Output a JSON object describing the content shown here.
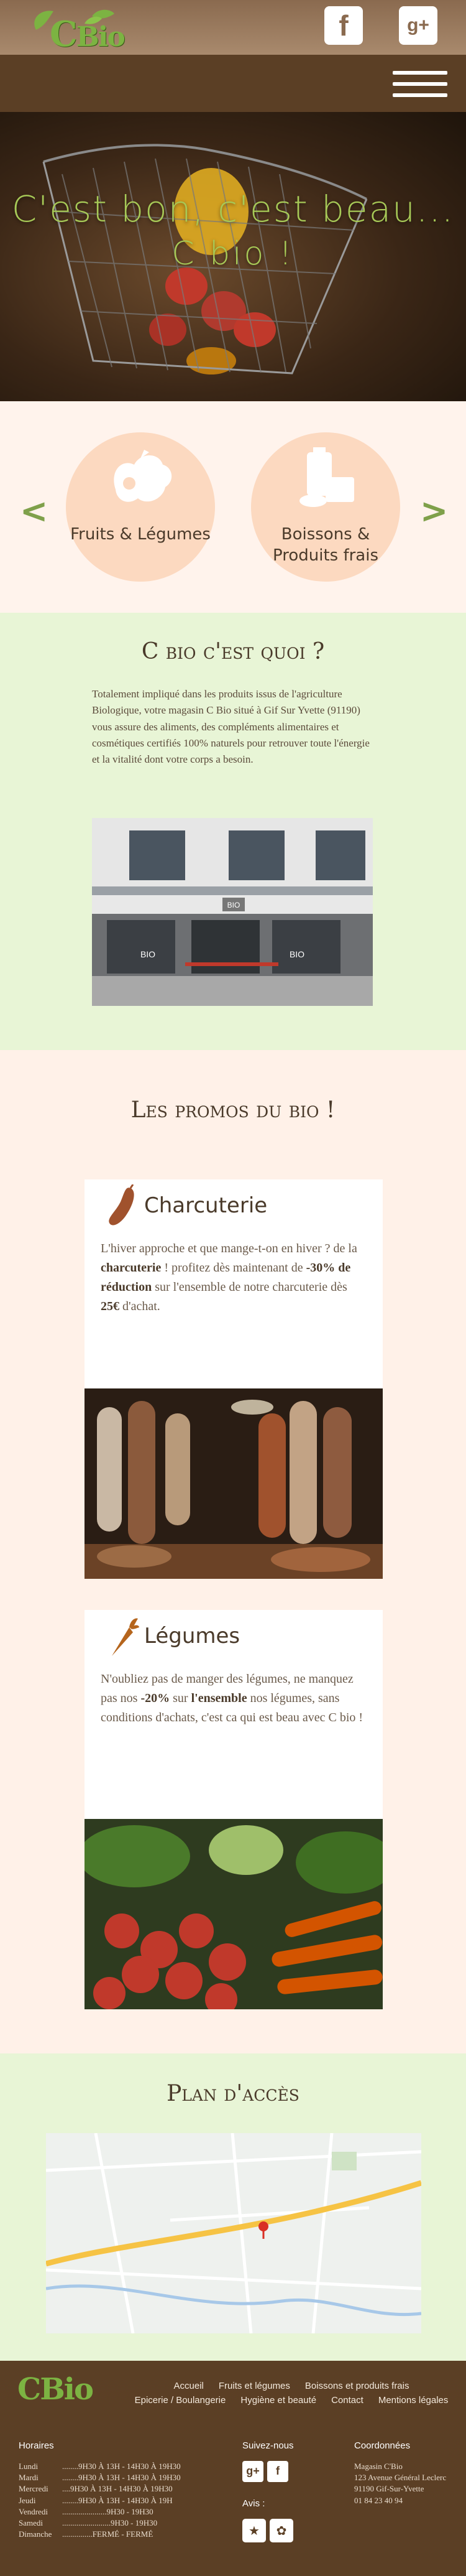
{
  "header": {
    "logo_text": "Bio",
    "logo_initial": "C",
    "facebook_glyph": "f",
    "googleplus_glyph": "g+"
  },
  "hero": {
    "line1": "C'est bon,  c'est beau...",
    "line2": "C bio !"
  },
  "categories": [
    {
      "label": "Fruits & Légumes",
      "icon": "fruits-vegetables-icon"
    },
    {
      "label": "Boissons & Produits frais",
      "icon": "drinks-fresh-icon"
    }
  ],
  "about": {
    "title": "C bio c'est quoi ?",
    "text": "Totalement impliqué dans les produits issus de l'agriculture Biologique, votre magasin C Bio situé à Gif Sur Yvette (91190) vous assure des aliments, des compléments alimentaires et cosmétiques certifiés 100% naturels pour retrouver toute l'énergie et la vitalité dont votre corps a besoin.",
    "store_sign": "BIO"
  },
  "promos": {
    "title": "Les promos du bio !",
    "cards": [
      {
        "heading": "Charcuterie",
        "text_a": "L'hiver approche et que mange-t-on en hiver ? de la ",
        "bold_a": "charcuterie",
        "text_b": " ! profitez dès maintenant de ",
        "bold_b": "-30% de réduction",
        "text_c": " sur l'ensemble de notre charcuterie  dès ",
        "bold_c": "25€",
        "text_d": " d'achat."
      },
      {
        "heading": "Légumes",
        "text_a": "N'oubliez pas de manger des légumes, ne manquez pas nos ",
        "bold_a": "-20%",
        "text_b": " sur ",
        "bold_b": "l'ensemble",
        "text_c": " nos légumes, sans conditions d'achats, c'est ca qui est beau avec C bio !"
      }
    ]
  },
  "access": {
    "title": "Plan d'accès"
  },
  "footer": {
    "logo_text": "CBio",
    "nav": [
      "Accueil",
      "Fruits et légumes",
      "Boissons et produits frais",
      "Epicerie / Boulangerie",
      "Hygiène et beauté",
      "Contact",
      "Mentions légales"
    ],
    "hours_title": "Horaires",
    "hours": [
      {
        "day": "Lundi",
        "time": "........9H30 À 13H  -  14H30 À 19H30"
      },
      {
        "day": "Mardi",
        "time": "........9H30 À 13H  -  14H30 À 19H30"
      },
      {
        "day": "Mercredi",
        "time": "....9H30 À 13H  -  14H30 À 19H30"
      },
      {
        "day": "Jeudi",
        "time": "........9H30 À 13H  -  14H30 À 19H"
      },
      {
        "day": "Vendredi",
        "time": "......................9H30  -  19H30"
      },
      {
        "day": "Samedi",
        "time": "........................9H30  -  19H30"
      },
      {
        "day": "Dimanche",
        "time": "...............FERMÉ  -  FERMÉ"
      }
    ],
    "follow_title": "Suivez-nous",
    "follow_icons": [
      "g+",
      "f"
    ],
    "avis_title": "Avis :",
    "coords_title": "Coordonnées",
    "coords": [
      "Magasin C'Bio",
      "123 Avenue Général Leclerc",
      "91190 Gif-Sur-Yvette",
      "01 84 23 40 94"
    ]
  }
}
